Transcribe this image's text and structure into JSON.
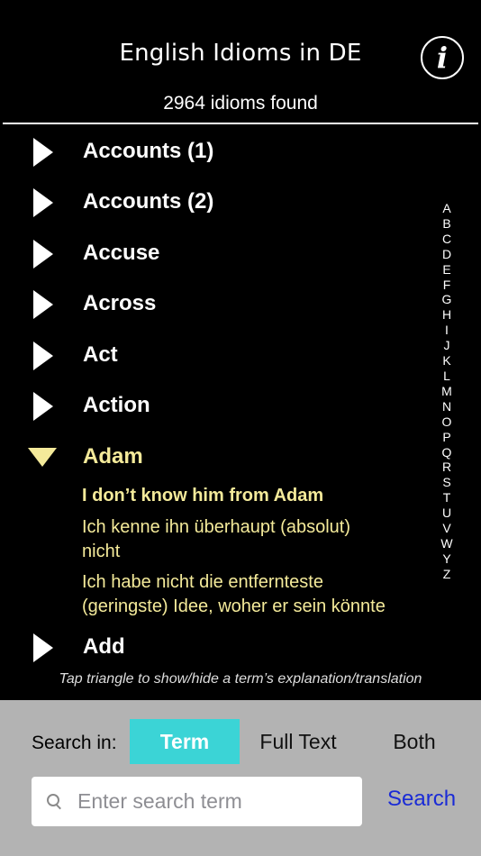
{
  "header": {
    "title": "English Idioms in DE",
    "info_icon": "i",
    "count_text": "2964 idioms found"
  },
  "list": {
    "items": [
      {
        "label": "Accounts (1)",
        "expanded": false
      },
      {
        "label": "Accounts (2)",
        "expanded": false
      },
      {
        "label": "Accuse",
        "expanded": false
      },
      {
        "label": "Across",
        "expanded": false
      },
      {
        "label": "Act",
        "expanded": false
      },
      {
        "label": "Action",
        "expanded": false
      },
      {
        "label": "Adam",
        "expanded": true
      },
      {
        "label": "Add",
        "expanded": false
      }
    ],
    "expanded": {
      "idiom": "I don’t know him from Adam",
      "translation_1_line_1": "Ich kenne ihn überhaupt (absolut)",
      "translation_1_line_2": "nicht",
      "translation_2_line_1": "Ich habe nicht die entfernteste",
      "translation_2_line_2": "(geringste) Idee, woher er sein könnte"
    }
  },
  "index_letters": [
    "A",
    "B",
    "C",
    "D",
    "E",
    "F",
    "G",
    "H",
    "I",
    "J",
    "K",
    "L",
    "M",
    "N",
    "O",
    "P",
    "Q",
    "R",
    "S",
    "T",
    "U",
    "V",
    "W",
    "Y",
    "Z"
  ],
  "hint": "Tap triangle to show/hide a term’s explanation/translation",
  "search": {
    "label": "Search in:",
    "options": [
      "Term",
      "Full Text",
      "Both"
    ],
    "selected": "Term",
    "placeholder": "Enter search term",
    "value": "",
    "button_label": "Search"
  },
  "colors": {
    "background": "#000000",
    "expanded_text": "#f4ea9a",
    "segment_active": "#3bd4d6",
    "search_link": "#1a2bd6",
    "panel": "#b3b3b3"
  }
}
